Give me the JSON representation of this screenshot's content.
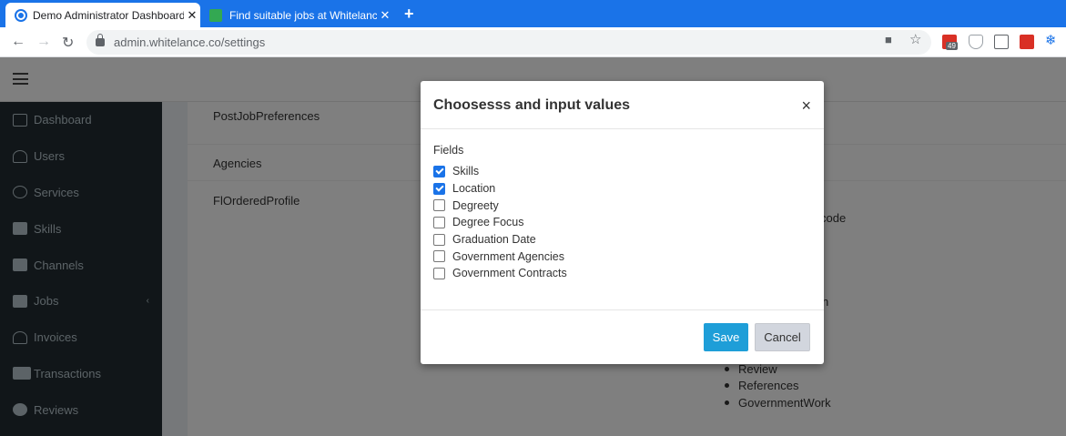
{
  "browser": {
    "tabs": [
      {
        "label": "Demo Administrator Dashboard"
      },
      {
        "label": "Find suitable jobs at Whitelance."
      }
    ],
    "url": "admin.whitelance.co/settings",
    "ext_badge": "49"
  },
  "sidebar": {
    "items": [
      {
        "label": "Dashboard"
      },
      {
        "label": "Users"
      },
      {
        "label": "Services"
      },
      {
        "label": "Skills"
      },
      {
        "label": "Channels"
      },
      {
        "label": "Jobs"
      },
      {
        "label": "Invoices"
      },
      {
        "label": "Transactions"
      },
      {
        "label": "Reviews"
      }
    ]
  },
  "settings": {
    "rows": [
      "PostJobPreferences",
      "Agencies",
      "FlOrderedProfile"
    ],
    "partial_text_1": "code",
    "partial_text_2": "n",
    "list_items": [
      "Review",
      "References",
      "GovernmentWork"
    ]
  },
  "modal": {
    "title": "Choosesss and input values",
    "fields_label": "Fields",
    "fields": [
      {
        "label": "Skills",
        "checked": true
      },
      {
        "label": "Location",
        "checked": true
      },
      {
        "label": "Degreety",
        "checked": false
      },
      {
        "label": "Degree Focus",
        "checked": false
      },
      {
        "label": "Graduation Date",
        "checked": false
      },
      {
        "label": "Government Agencies",
        "checked": false
      },
      {
        "label": "Government Contracts",
        "checked": false
      }
    ],
    "save_label": "Save",
    "cancel_label": "Cancel",
    "close_glyph": "×"
  },
  "colors": {
    "chrome_blue": "#1a73e8",
    "sidebar_bg": "#222d32",
    "save_button": "#1e9ed8"
  }
}
